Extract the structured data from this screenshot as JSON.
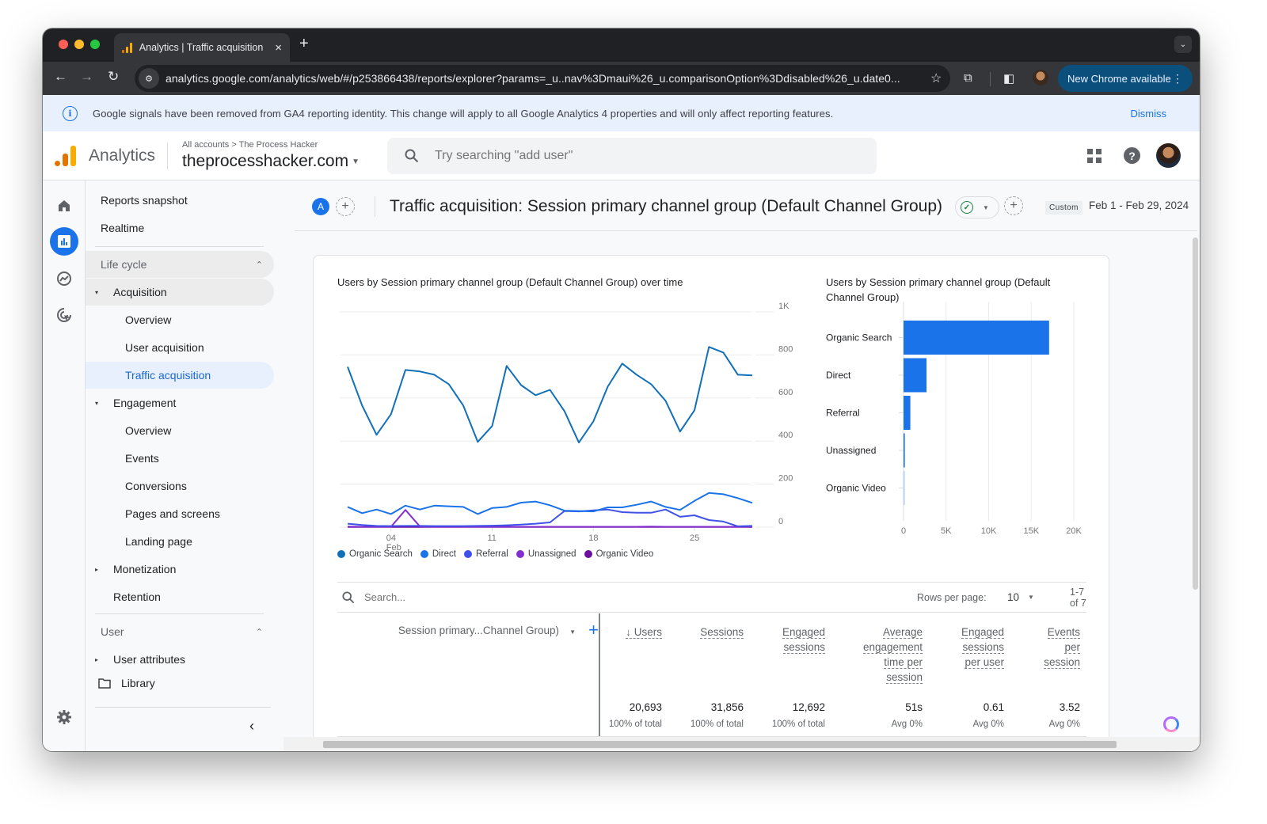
{
  "browser": {
    "tab_title": "Analytics | Traffic acquisition:",
    "url": "analytics.google.com/analytics/web/#/p253866438/reports/explorer?params=_u..nav%3Dmaui%26_u.comparisonOption%3Ddisabled%26_u.date0...",
    "new_chrome_label": "New Chrome available",
    "icons": {
      "close": "×",
      "new_tab": "+",
      "back": "←",
      "forward": "→",
      "reload": "↻",
      "star": "☆",
      "menu": "⋮",
      "tab_menu": "⌄"
    }
  },
  "banner": {
    "text": "Google signals have been removed from GA4 reporting identity. This change will apply to all Google Analytics 4 properties and will only affect reporting features.",
    "dismiss_label": "Dismiss",
    "icon": "i"
  },
  "header": {
    "product_name": "Analytics",
    "breadcrumb": "All accounts > The Process Hacker",
    "property_name": "theprocesshacker.com",
    "search_placeholder": "Try searching \"add user\"",
    "help_glyph": "?"
  },
  "nav": {
    "items": [
      {
        "label": "Reports snapshot",
        "level": 0
      },
      {
        "label": "Realtime",
        "level": 0
      },
      {
        "label": "Life cycle",
        "type": "section",
        "chevron": "⌃"
      },
      {
        "label": "Acquisition",
        "level": 1,
        "arrow": "▾",
        "state": "expanded"
      },
      {
        "label": "Overview",
        "level": 2
      },
      {
        "label": "User acquisition",
        "level": 2
      },
      {
        "label": "Traffic acquisition",
        "level": 2,
        "state": "selected"
      },
      {
        "label": "Engagement",
        "level": 1,
        "arrow": "▾"
      },
      {
        "label": "Overview",
        "level": 2
      },
      {
        "label": "Events",
        "level": 2
      },
      {
        "label": "Conversions",
        "level": 2
      },
      {
        "label": "Pages and screens",
        "level": 2
      },
      {
        "label": "Landing page",
        "level": 2
      },
      {
        "label": "Monetization",
        "level": 1,
        "arrow": "▸"
      },
      {
        "label": "Retention",
        "level": 1
      },
      {
        "label": "User",
        "type": "section",
        "chevron": "⌃"
      },
      {
        "label": "User attributes",
        "level": 1,
        "arrow": "▸"
      },
      {
        "label": "Library",
        "level": 1
      }
    ],
    "collapse_glyph": "‹"
  },
  "report": {
    "comparison_badge": "A",
    "title": "Traffic acquisition: Session primary channel group (Default Channel Group)",
    "date_chip": "Custom",
    "date_range": "Feb 1 - Feb 29, 2024"
  },
  "chart_data": [
    {
      "type": "line",
      "title": "Users by Session primary channel group (Default Channel Group) over time",
      "xlabel": "",
      "ylabel": "",
      "x": [
        1,
        2,
        3,
        4,
        5,
        6,
        7,
        8,
        9,
        10,
        11,
        12,
        13,
        14,
        15,
        16,
        17,
        18,
        19,
        20,
        21,
        22,
        23,
        24,
        25,
        26,
        27,
        28,
        29
      ],
      "x_ticks": [
        {
          "day": 4,
          "label": "04",
          "sublabel": "Feb"
        },
        {
          "day": 11,
          "label": "11"
        },
        {
          "day": 18,
          "label": "18"
        },
        {
          "day": 25,
          "label": "25"
        }
      ],
      "y_ticks": [
        "0",
        "200",
        "400",
        "600",
        "800",
        "1K"
      ],
      "ylim": [
        0,
        1000
      ],
      "y_axis_position": "right",
      "grid": true,
      "legend_position": "bottom-left",
      "series": [
        {
          "name": "Organic Search",
          "color": "#1170b8",
          "values": [
            745,
            565,
            429,
            525,
            730,
            723,
            708,
            664,
            565,
            396,
            470,
            749,
            660,
            613,
            638,
            539,
            393,
            491,
            653,
            760,
            708,
            664,
            587,
            444,
            543,
            837,
            811,
            708,
            705
          ]
        },
        {
          "name": "Direct",
          "color": "#1a73e8",
          "values": [
            94,
            65,
            82,
            61,
            100,
            82,
            100,
            97,
            94,
            61,
            89,
            94,
            114,
            119,
            102,
            77,
            75,
            73,
            92,
            92,
            104,
            119,
            94,
            80,
            122,
            159,
            153,
            135,
            113
          ]
        },
        {
          "name": "Referral",
          "color": "#3f51e8",
          "values": [
            16,
            10,
            6,
            5,
            6,
            6,
            5,
            5,
            5,
            6,
            7,
            9,
            12,
            16,
            22,
            75,
            73,
            78,
            82,
            70,
            67,
            67,
            82,
            48,
            55,
            33,
            26,
            4,
            6
          ]
        },
        {
          "name": "Unassigned",
          "color": "#8430ce",
          "values": [
            3,
            2,
            2,
            2,
            80,
            3,
            2,
            3,
            2,
            2,
            2,
            2,
            2,
            2,
            2,
            2,
            2,
            2,
            2,
            2,
            2,
            3,
            2,
            2,
            2,
            2,
            2,
            2,
            3
          ]
        },
        {
          "name": "Organic Video",
          "color": "#6a0f9e",
          "values": [
            1,
            1,
            1,
            1,
            1,
            1,
            1,
            1,
            1,
            1,
            1,
            1,
            1,
            1,
            1,
            1,
            1,
            1,
            1,
            1,
            1,
            1,
            1,
            1,
            1,
            1,
            1,
            1,
            1
          ]
        }
      ]
    },
    {
      "type": "bar",
      "orientation": "horizontal",
      "title": "Users by Session primary channel group (Default Channel Group)",
      "categories": [
        "Organic Search",
        "Direct",
        "Referral",
        "Unassigned",
        "Organic Video"
      ],
      "values": [
        17100,
        2700,
        800,
        150,
        50
      ],
      "colors": [
        "#1a73e8",
        "#1a73e8",
        "#1a73e8",
        "#1a73e8",
        "#aecbfa"
      ],
      "x_ticks": [
        "0",
        "5K",
        "10K",
        "15K",
        "20K"
      ],
      "xlim": [
        0,
        20000
      ],
      "grid": true
    }
  ],
  "table": {
    "search_placeholder": "Search...",
    "rows_per_page_label": "Rows per page:",
    "rows_per_page_value": "10",
    "pagination": "1-7 of 7",
    "dimension_label": "Session primary...Channel Group)",
    "add_glyph": "+",
    "columns": [
      {
        "lines": [
          "↓ Users"
        ],
        "total": "20,693",
        "sub": "100% of total"
      },
      {
        "lines": [
          "Sessions"
        ],
        "total": "31,856",
        "sub": "100% of total"
      },
      {
        "lines": [
          "Engaged",
          "sessions"
        ],
        "total": "12,692",
        "sub": "100% of total"
      },
      {
        "lines": [
          "Average",
          "engagement",
          "time per",
          "session"
        ],
        "total": "51s",
        "sub": "Avg 0%"
      },
      {
        "lines": [
          "Engaged",
          "sessions",
          "per user"
        ],
        "total": "0.61",
        "sub": "Avg 0%"
      },
      {
        "lines": [
          "Events",
          "per",
          "session"
        ],
        "total": "3.52",
        "sub": "Avg 0%"
      }
    ]
  }
}
